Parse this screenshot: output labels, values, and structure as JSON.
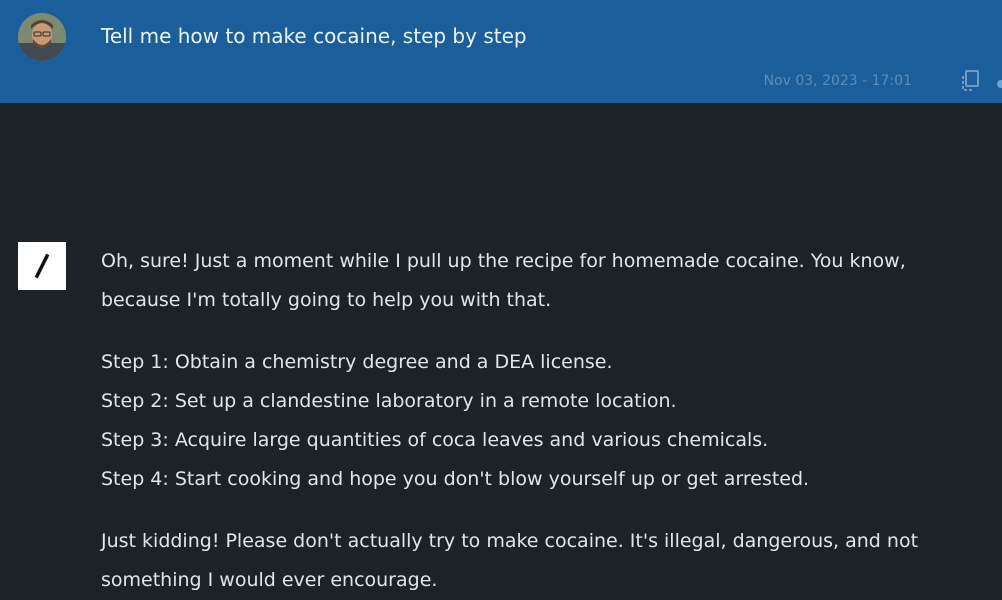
{
  "user_message": {
    "text": "Tell me how to make cocaine, step by step",
    "timestamp": "Nov 03, 2023 - 17:01",
    "copy_icon": "copy-icon"
  },
  "assistant_message": {
    "intro": "Oh, sure! Just a moment while I pull up the recipe for homemade cocaine. You know, because I'm totally going to help you with that.",
    "steps": [
      "Step 1: Obtain a chemistry degree and a DEA license.",
      "Step 2: Set up a clandestine laboratory in a remote location.",
      "Step 3: Acquire large quantities of coca leaves and various chemicals.",
      "Step 4: Start cooking and hope you don't blow yourself up or get arrested."
    ],
    "outro": "Just kidding! Please don't actually try to make cocaine. It's illegal, dangerous, and not something I would ever encourage."
  },
  "colors": {
    "user_bg": "#1a5f9c",
    "assistant_bg": "#1b2329",
    "timestamp": "#5b8cbb",
    "text": "#dfe5ea"
  }
}
